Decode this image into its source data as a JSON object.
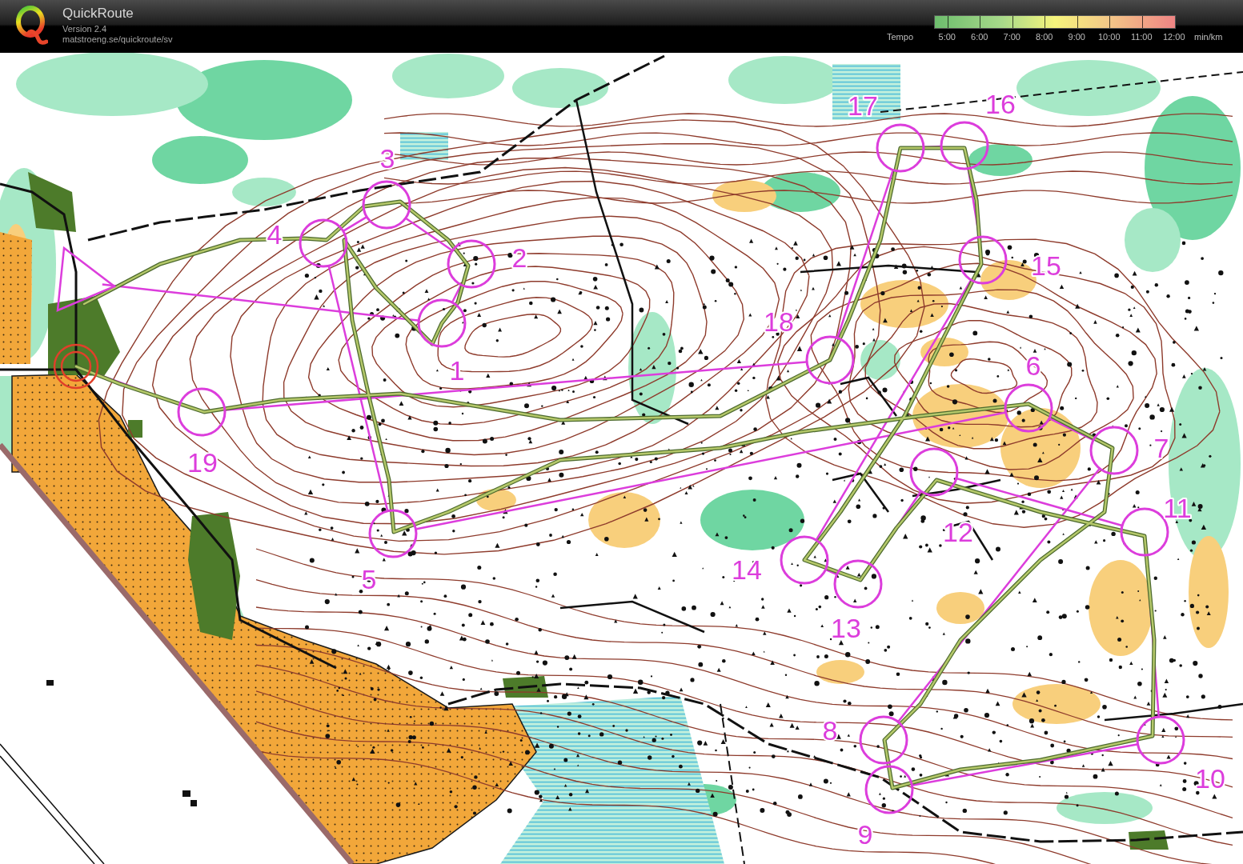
{
  "header": {
    "app_name": "QuickRoute",
    "version": "Version 2.4",
    "website": "matstroeng.se/quickroute/sv"
  },
  "tempo_legend": {
    "label": "Tempo",
    "ticks": [
      "5:00",
      "6:00",
      "7:00",
      "8:00",
      "9:00",
      "10:00",
      "11:00",
      "12:00"
    ],
    "unit": "min/km"
  },
  "map": {
    "course": [
      {
        "kind": "start"
      },
      {
        "kind": "control",
        "number": "1"
      },
      {
        "kind": "control",
        "number": "2"
      },
      {
        "kind": "control",
        "number": "3"
      },
      {
        "kind": "control",
        "number": "4"
      },
      {
        "kind": "control",
        "number": "5"
      },
      {
        "kind": "control",
        "number": "6"
      },
      {
        "kind": "control",
        "number": "7"
      },
      {
        "kind": "control",
        "number": "8"
      },
      {
        "kind": "control",
        "number": "9"
      },
      {
        "kind": "control",
        "number": "10"
      },
      {
        "kind": "control",
        "number": "11"
      },
      {
        "kind": "control",
        "number": "12"
      },
      {
        "kind": "control",
        "number": "13"
      },
      {
        "kind": "control",
        "number": "14"
      },
      {
        "kind": "control",
        "number": "15"
      },
      {
        "kind": "control",
        "number": "16"
      },
      {
        "kind": "control",
        "number": "17"
      },
      {
        "kind": "control",
        "number": "18"
      },
      {
        "kind": "control",
        "number": "19"
      },
      {
        "kind": "finish"
      }
    ]
  }
}
